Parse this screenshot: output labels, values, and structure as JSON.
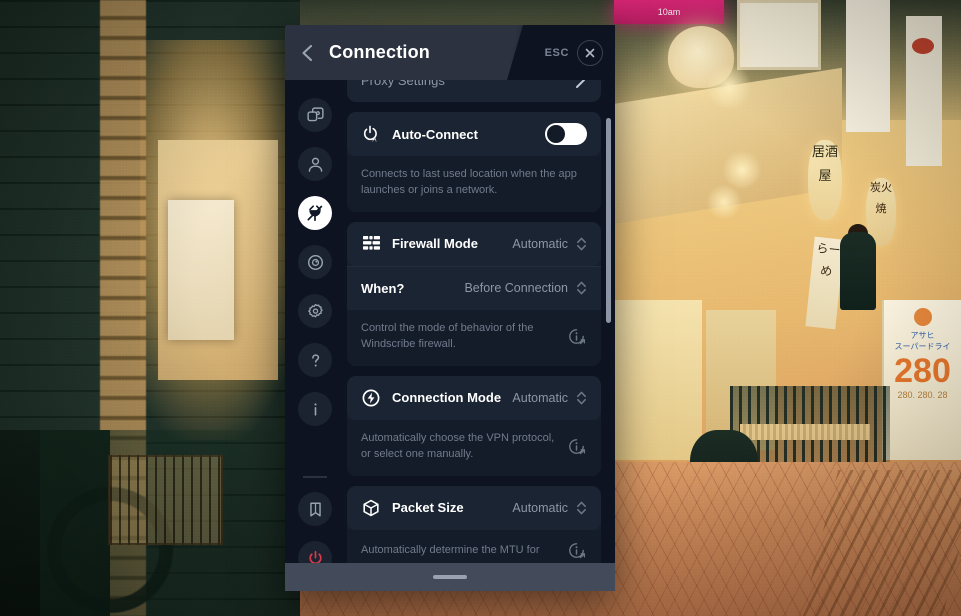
{
  "window": {
    "title": "Connection",
    "esc_label": "ESC",
    "back_icon": "chevron-left-icon",
    "close_icon": "close-icon"
  },
  "sidebar": {
    "items": [
      {
        "icon": "general-overlay-icon",
        "name": "general",
        "active": false
      },
      {
        "icon": "account-person-icon",
        "name": "account",
        "active": false
      },
      {
        "icon": "connection-plug-icon",
        "name": "connection",
        "active": true
      },
      {
        "icon": "robert-target-icon",
        "name": "robert",
        "active": false
      },
      {
        "icon": "gear-icon",
        "name": "preferences",
        "active": false
      },
      {
        "icon": "help-question-icon",
        "name": "help",
        "active": false
      },
      {
        "icon": "about-info-icon",
        "name": "about",
        "active": false
      }
    ],
    "footer_items": [
      {
        "icon": "shield-badge-icon",
        "name": "shield"
      },
      {
        "icon": "power-icon",
        "name": "power",
        "color": "#d93a4a"
      }
    ]
  },
  "content": {
    "cards": [
      {
        "id": "proxy-settings",
        "label": "Proxy Settings",
        "icon": null,
        "trailing": "chevron-right-icon",
        "muted_label": true
      },
      {
        "id": "auto-connect",
        "label": "Auto-Connect",
        "icon": "power-auto-icon",
        "toggle": {
          "on": false
        },
        "description": "Connects to last used location when the app launches or joins a network."
      },
      {
        "id": "firewall-mode",
        "label": "Firewall Mode",
        "icon": "firewall-brick-icon",
        "value": "Automatic",
        "trailing": "chevron-updown-icon",
        "sub_row": {
          "label": "When?",
          "value": "Before Connection",
          "trailing": "chevron-updown-icon"
        },
        "description": "Control the mode of behavior of the Windscribe firewall.",
        "info": "info-external-link-icon"
      },
      {
        "id": "connection-mode",
        "label": "Connection Mode",
        "icon": "bolt-circle-icon",
        "value": "Automatic",
        "trailing": "chevron-updown-icon",
        "description": "Automatically choose the VPN protocol, or select one manually.",
        "info": "info-external-link-icon"
      },
      {
        "id": "packet-size",
        "label": "Packet Size",
        "icon": "box-cube-icon",
        "value": "Automatic",
        "trailing": "chevron-updown-icon",
        "description": "Automatically determine the MTU for",
        "info": "info-external-link-icon"
      }
    ]
  },
  "bottom_bar": {
    "handle": "drag-handle"
  },
  "wallpaper": {
    "pink_sign_text": "10am",
    "lantern_1_text": "居酒屋",
    "lantern_2_text": "炭火焼",
    "banner_text": "らーめ",
    "beer_sign": {
      "brand": "アサヒ",
      "product": "スーパードライ",
      "price": "280",
      "row": "280. 280. 28"
    }
  },
  "colors": {
    "panel_bg": "#0d1320",
    "card_bg": "#1b2432",
    "desc_bg": "#141c2a",
    "header_bg": "#2c323f",
    "accent_white": "#ffffff",
    "power_red": "#d93a4a",
    "muted_text": "#8d96a5",
    "bottom_bar": "#434a5a"
  }
}
